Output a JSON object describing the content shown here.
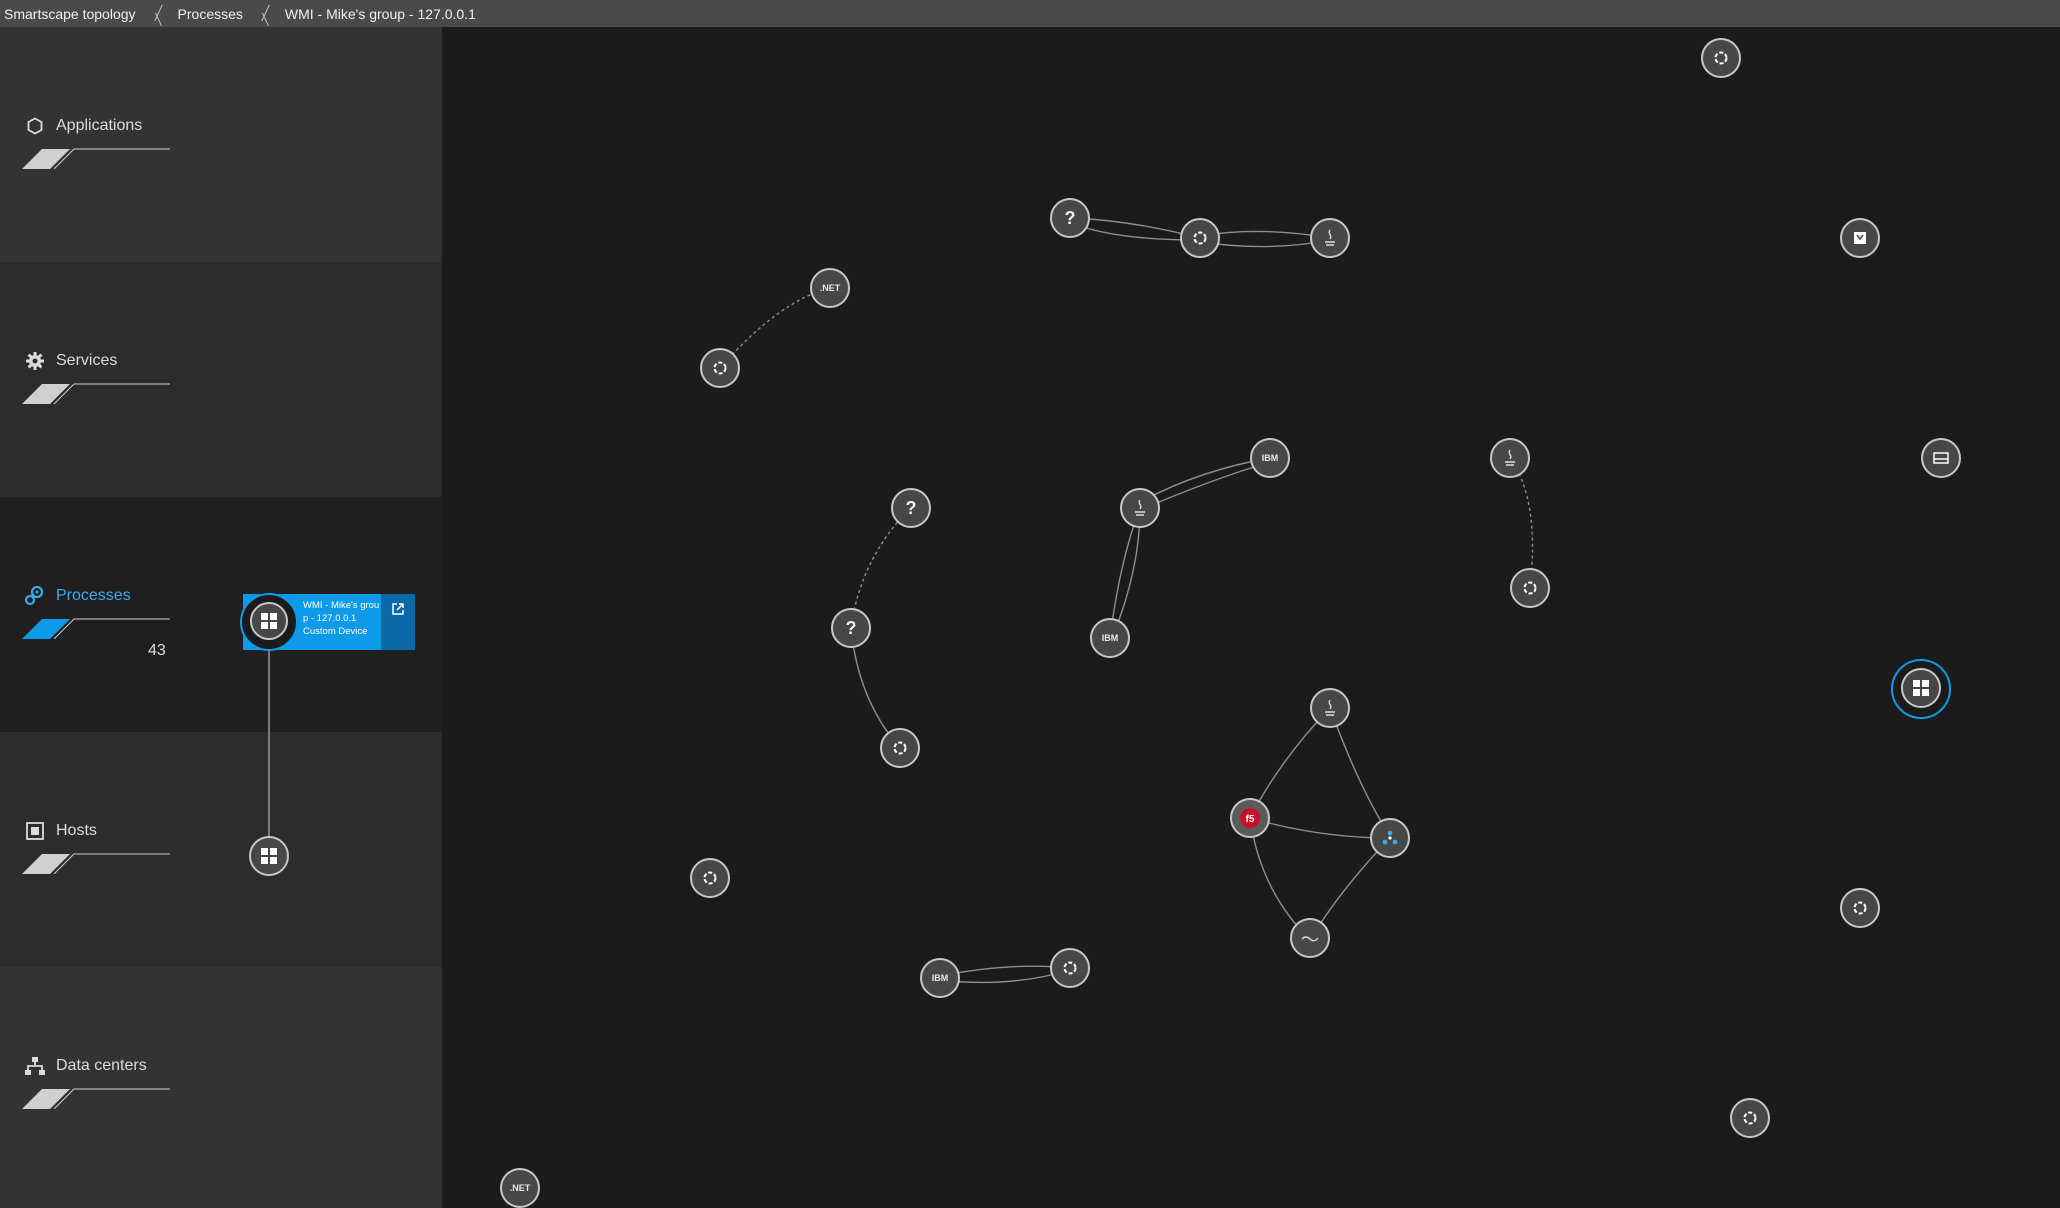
{
  "breadcrumb": [
    {
      "label": "Smartscape topology"
    },
    {
      "label": "Processes"
    },
    {
      "label": "WMI - Mike's group - 127.0.0.1"
    }
  ],
  "sidebar": {
    "panels": [
      {
        "label": "Applications",
        "icon": "hexagon-icon",
        "count": ""
      },
      {
        "label": "Services",
        "icon": "gear-icon",
        "count": ""
      },
      {
        "label": "Processes",
        "icon": "processes-icon",
        "count": "43",
        "active": true
      },
      {
        "label": "Hosts",
        "icon": "host-icon",
        "count": ""
      },
      {
        "label": "Data centers",
        "icon": "datacenter-icon",
        "count": ""
      }
    ]
  },
  "tooltip": {
    "title": "WMI - Mike's group - 127.0.0.1",
    "subtitle": "Custom Device"
  },
  "node_labels": {
    "net": ".NET",
    "ibm": "IBM",
    "unknown": "?"
  },
  "colors": {
    "accent": "#0d9ae8",
    "topbar": "#4a4a4a",
    "canvas": "#1b1b1b",
    "node_fill": "#474747",
    "node_border": "#c8c8c8"
  }
}
